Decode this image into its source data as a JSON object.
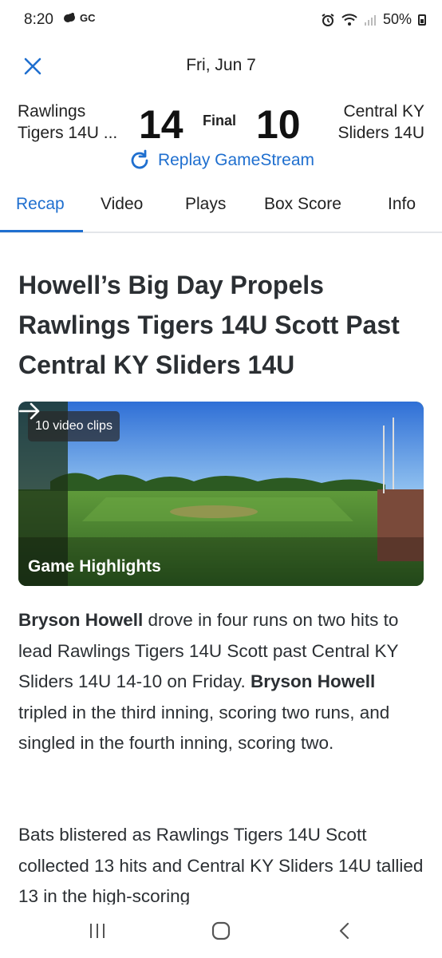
{
  "status_bar": {
    "time": "8:20",
    "carrier_badge": "GC",
    "battery": "50%"
  },
  "header": {
    "date": "Fri, Jun 7"
  },
  "score": {
    "home_team_line1": "Rawlings",
    "home_team_line2": "Tigers 14U ...",
    "home_score": "14",
    "status": "Final",
    "away_score": "10",
    "away_team_line1": "Central KY",
    "away_team_line2": "Sliders 14U",
    "replay_label": "Replay GameStream"
  },
  "tabs": [
    {
      "label": "Recap",
      "active": true
    },
    {
      "label": "Video",
      "active": false
    },
    {
      "label": "Plays",
      "active": false
    },
    {
      "label": "Box Score",
      "active": false
    },
    {
      "label": "Info",
      "active": false
    }
  ],
  "article": {
    "headline": "Howell’s Big Day Propels Rawlings Tigers 14U Scott Past Central KY Sliders 14U",
    "video": {
      "clips_badge": "10 video clips",
      "label": "Game Highlights"
    },
    "p1": {
      "name1": "Bryson Howell",
      "text1": " drove in four runs on two hits to lead Rawlings Tigers 14U Scott past Central KY Sliders 14U 14-10 on Friday. ",
      "name2": "Bryson Howell",
      "text2": " tripled in the third inning, scoring two runs, and singled in the fourth inning, scoring two."
    },
    "p2": "Bats blistered as Rawlings Tigers 14U Scott collected 13 hits and Central KY Sliders 14U tallied 13 in the high-scoring"
  },
  "colors": {
    "accent": "#1f6fcf",
    "text": "#2b2f33"
  }
}
